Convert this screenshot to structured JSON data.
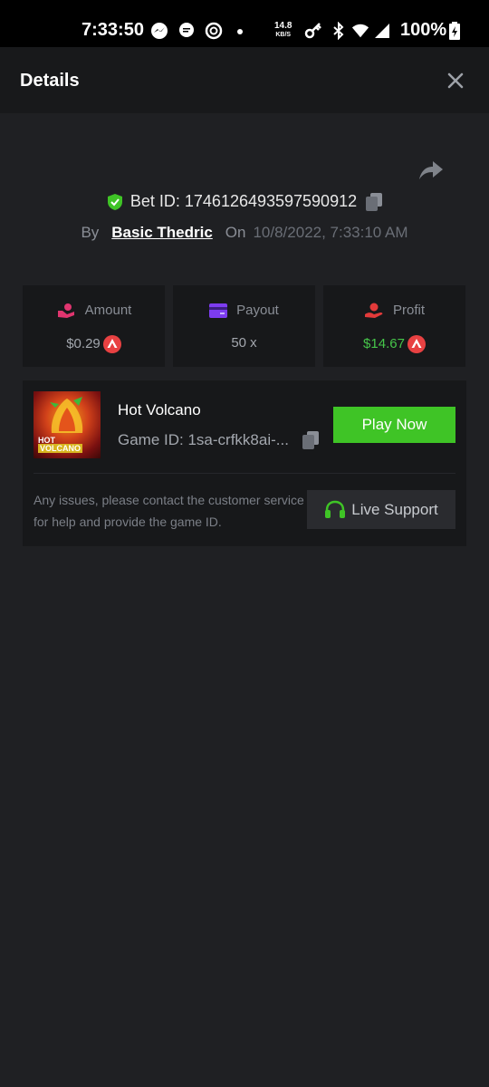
{
  "status_bar": {
    "time": "7:33:50",
    "net_speed_value": "14.8",
    "net_speed_unit": "KB/S",
    "battery": "100%"
  },
  "header": {
    "title": "Details"
  },
  "bet": {
    "bet_id": "Bet ID: 1746126493597590912",
    "by_label": "By",
    "user": "Basic Thedric",
    "on_label": "On",
    "date": "10/8/2022, 7:33:10 AM"
  },
  "stats": [
    {
      "label": "Amount",
      "value": "$0.29",
      "color": "#a3a7ae"
    },
    {
      "label": "Payout",
      "value": "50 x",
      "color": "#a3a7ae"
    },
    {
      "label": "Profit",
      "value": "$14.67",
      "color": "#46c54a"
    }
  ],
  "game": {
    "thumb_line1": "HOT",
    "thumb_line2": "VOLCANO",
    "name": "Hot Volcano",
    "game_id": "Game ID: 1sa-crfkk8ai-...",
    "play_label": "Play Now",
    "help_text": "Any issues, please contact the customer service for help and provide the game ID.",
    "support_label": "Live Support"
  },
  "colors": {
    "background": "#1f2023",
    "accent_green": "#3fc426",
    "profit_green": "#46c54a",
    "coin_red": "#e84142"
  }
}
